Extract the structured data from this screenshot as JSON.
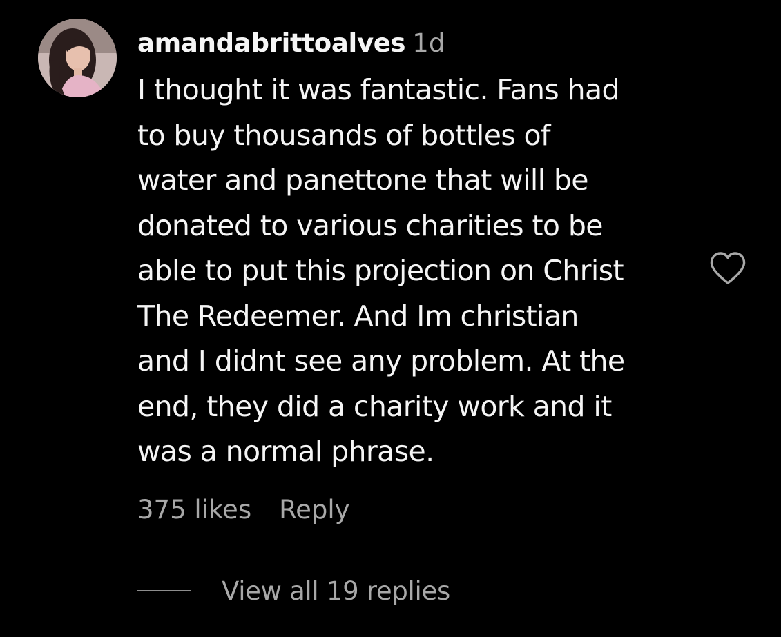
{
  "comment": {
    "username": "amandabrittoalves",
    "time": "1d",
    "avatar_icon": "profile-photo",
    "lines": [
      "I thought it was fantastic. Fans had",
      "to buy thousands of bottles of",
      "water and panettone that will be",
      "donated to various charities to be",
      "able to put this projection on Christ",
      "The Redeemer. And Im christian",
      "and I didnt see any problem. At the",
      "end, they did a charity work and it",
      "was a normal phrase."
    ],
    "likes_label": "375 likes",
    "reply_label": "Reply",
    "view_replies_label": "View all 19 replies",
    "like_icon": "heart-outline",
    "colors": {
      "background": "#000000",
      "primary_text": "#f5f5f5",
      "secondary_text": "#a8a8a8"
    }
  }
}
